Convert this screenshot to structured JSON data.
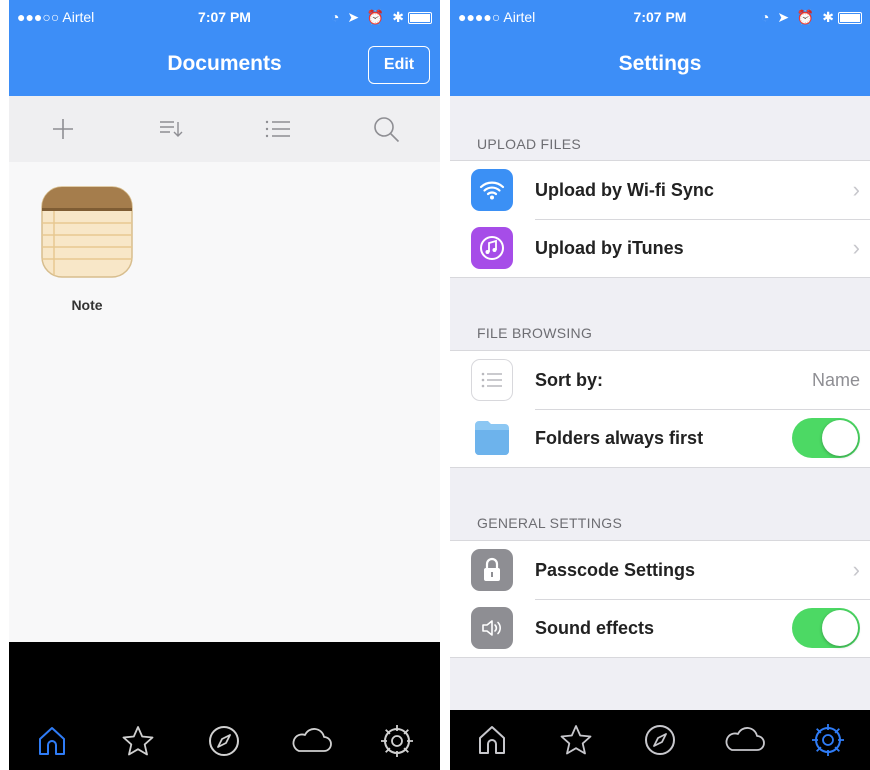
{
  "left_screen": {
    "status": {
      "carrier": "●●●○○ Airtel",
      "time": "7:07 PM"
    },
    "nav": {
      "title": "Documents",
      "edit_label": "Edit"
    },
    "toolbar": {
      "items": [
        "add-icon",
        "sort-icon",
        "list-icon",
        "search-icon"
      ]
    },
    "documents": [
      {
        "name": "Note",
        "icon": "note-icon"
      }
    ],
    "tabbar": {
      "items": [
        "home-icon",
        "star-icon",
        "compass-icon",
        "cloud-icon",
        "settings-icon"
      ],
      "active": "home-icon"
    }
  },
  "right_screen": {
    "status": {
      "carrier": "●●●●○ Airtel",
      "time": "7:07 PM"
    },
    "nav": {
      "title": "Settings"
    },
    "sections": [
      {
        "header": "UPLOAD FILES",
        "rows": [
          {
            "label": "Upload by Wi-fi Sync",
            "icon": "wifi-icon",
            "accessory": "chevron"
          },
          {
            "label": "Upload by iTunes",
            "icon": "itunes-icon",
            "accessory": "chevron"
          }
        ]
      },
      {
        "header": "FILE BROWSING",
        "rows": [
          {
            "label": "Sort by:",
            "icon": "list-icon",
            "value": "Name"
          },
          {
            "label": "Folders always first",
            "icon": "folder-icon",
            "accessory": "toggle",
            "on": true
          }
        ]
      },
      {
        "header": "GENERAL SETTINGS",
        "rows": [
          {
            "label": "Passcode Settings",
            "icon": "lock-icon",
            "accessory": "chevron"
          },
          {
            "label": "Sound effects",
            "icon": "speaker-icon",
            "accessory": "toggle",
            "on": true
          }
        ]
      }
    ],
    "tabbar": {
      "items": [
        "home-icon",
        "star-icon",
        "compass-icon",
        "cloud-icon",
        "settings-icon"
      ],
      "active": "settings-icon"
    }
  },
  "colors": {
    "accent": "#3d8ef7",
    "toggle_on": "#4cd964",
    "tab_active": "#2f7cf6",
    "tab_inactive_left": "#d0d0d0",
    "tab_inactive_right": "#c7c7cc"
  }
}
